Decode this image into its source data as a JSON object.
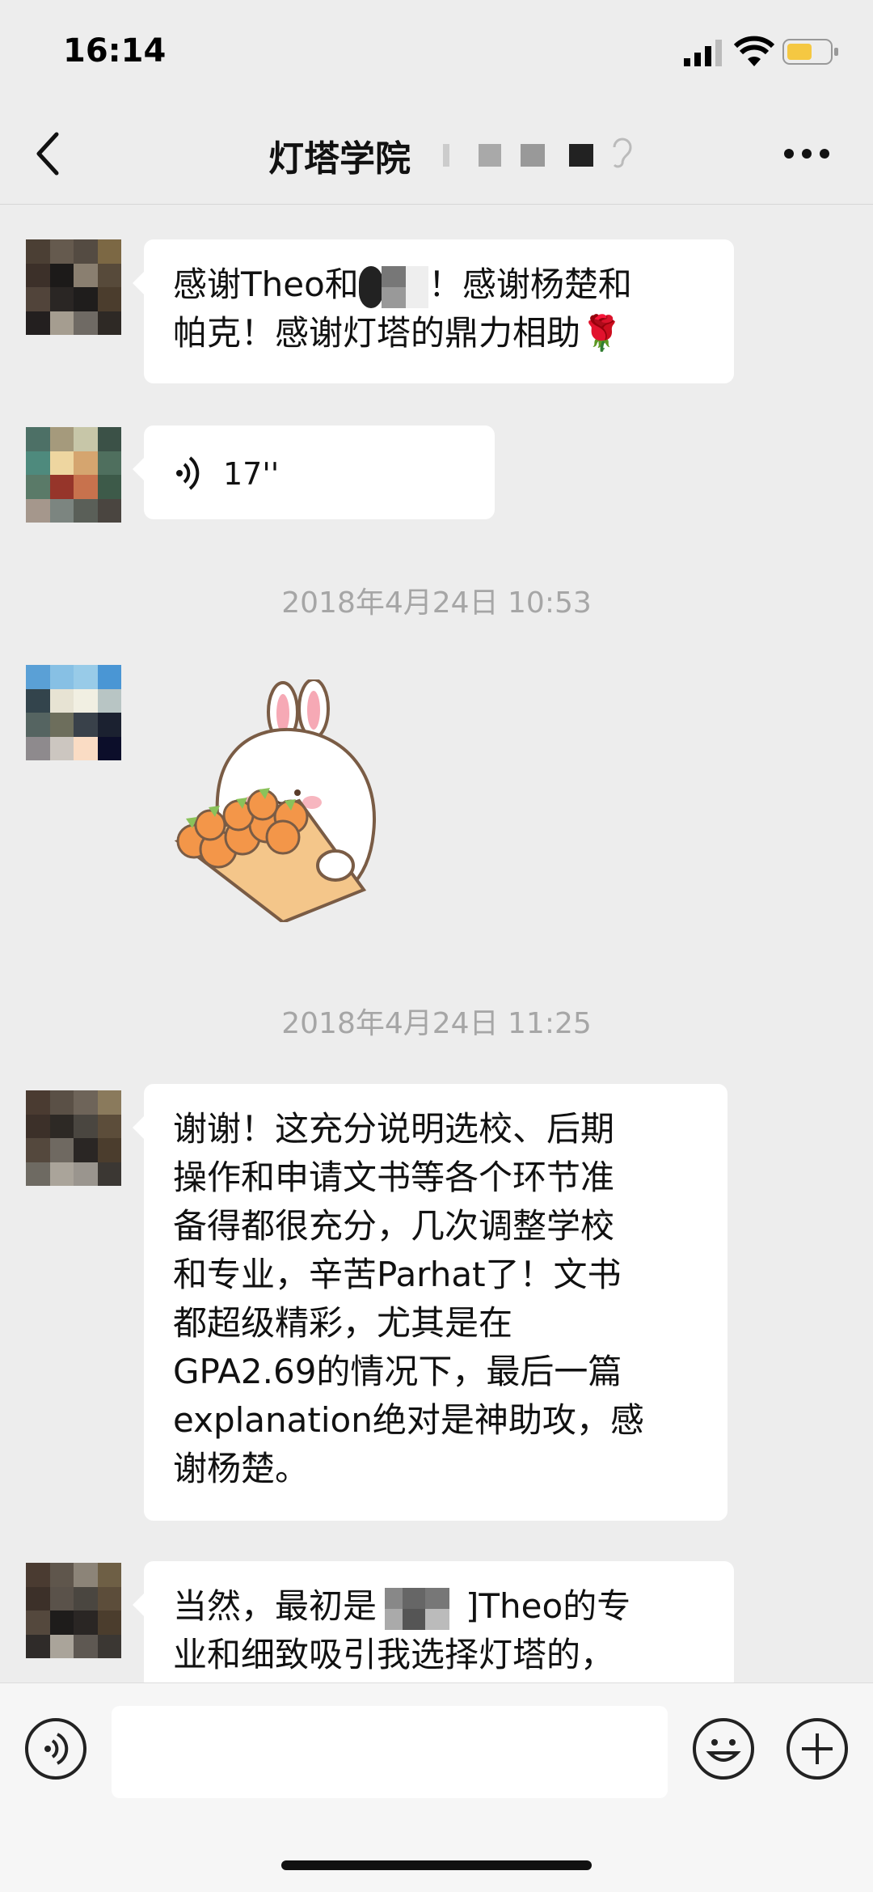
{
  "status_bar": {
    "time": "16:14"
  },
  "nav": {
    "title": "灯塔学院"
  },
  "messages": {
    "m1": {
      "line1_a": "感谢Theo和",
      "line1_b": "！感谢杨楚和",
      "line2": "帕克！感谢灯塔的鼎力相助",
      "rose": "🌹"
    },
    "m2": {
      "duration": "17''"
    },
    "ts1": "2018年4月24日 10:53",
    "ts2": "2018年4月24日 11:25",
    "m4": {
      "lines": [
        "谢谢！这充分说明选校、后期",
        "操作和申请文书等各个环节准",
        "备得都很充分，几次调整学校",
        "和专业，辛苦Parhat了！文书",
        "都超级精彩，尤其是在",
        "GPA2.69的情况下，最后一篇",
        "explanation绝对是神助攻，感",
        "谢杨楚。"
      ]
    },
    "m5": {
      "line1_a": "当然，最初是",
      "line1_b": "]Theo的专",
      "line2": "业和细致吸引我选择灯塔的，"
    }
  },
  "colors": {
    "background": "#ededed",
    "bubble": "#ffffff",
    "timestamp": "#a6a6a6"
  }
}
